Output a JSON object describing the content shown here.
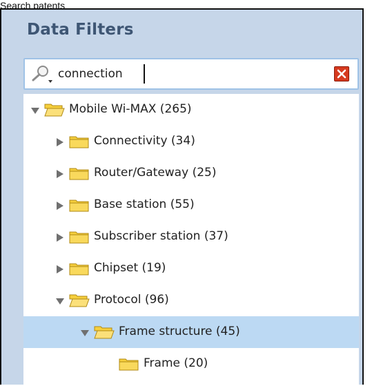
{
  "page": {
    "caption": "Search patents"
  },
  "panel": {
    "title": "Data Filters"
  },
  "search": {
    "value": "connection",
    "clear_icon": "close-icon",
    "search_icon": "magnifier-icon"
  },
  "tree": {
    "items": [
      {
        "label": "Mobile Wi-MAX (265)",
        "state": "expanded",
        "level": 0
      },
      {
        "label": "Connectivity (34)",
        "state": "collapsed",
        "level": 1
      },
      {
        "label": "Router/Gateway (25)",
        "state": "collapsed",
        "level": 1
      },
      {
        "label": "Base station (55)",
        "state": "collapsed",
        "level": 1
      },
      {
        "label": "Subscriber station (37)",
        "state": "collapsed",
        "level": 1
      },
      {
        "label": "Chipset (19)",
        "state": "collapsed",
        "level": 1
      },
      {
        "label": "Protocol (96)",
        "state": "expanded",
        "level": 1
      },
      {
        "label": "Frame structure (45)",
        "state": "expanded",
        "level": 2,
        "selected": true
      },
      {
        "label": "Frame (20)",
        "state": "leaf",
        "level": 3
      }
    ]
  },
  "colors": {
    "panel_bg": "#c6d6e9",
    "title": "#3e5674",
    "selected_row": "#bcd9f3",
    "folder": "#f6cf3c",
    "clear_button": "#d63a1f"
  }
}
